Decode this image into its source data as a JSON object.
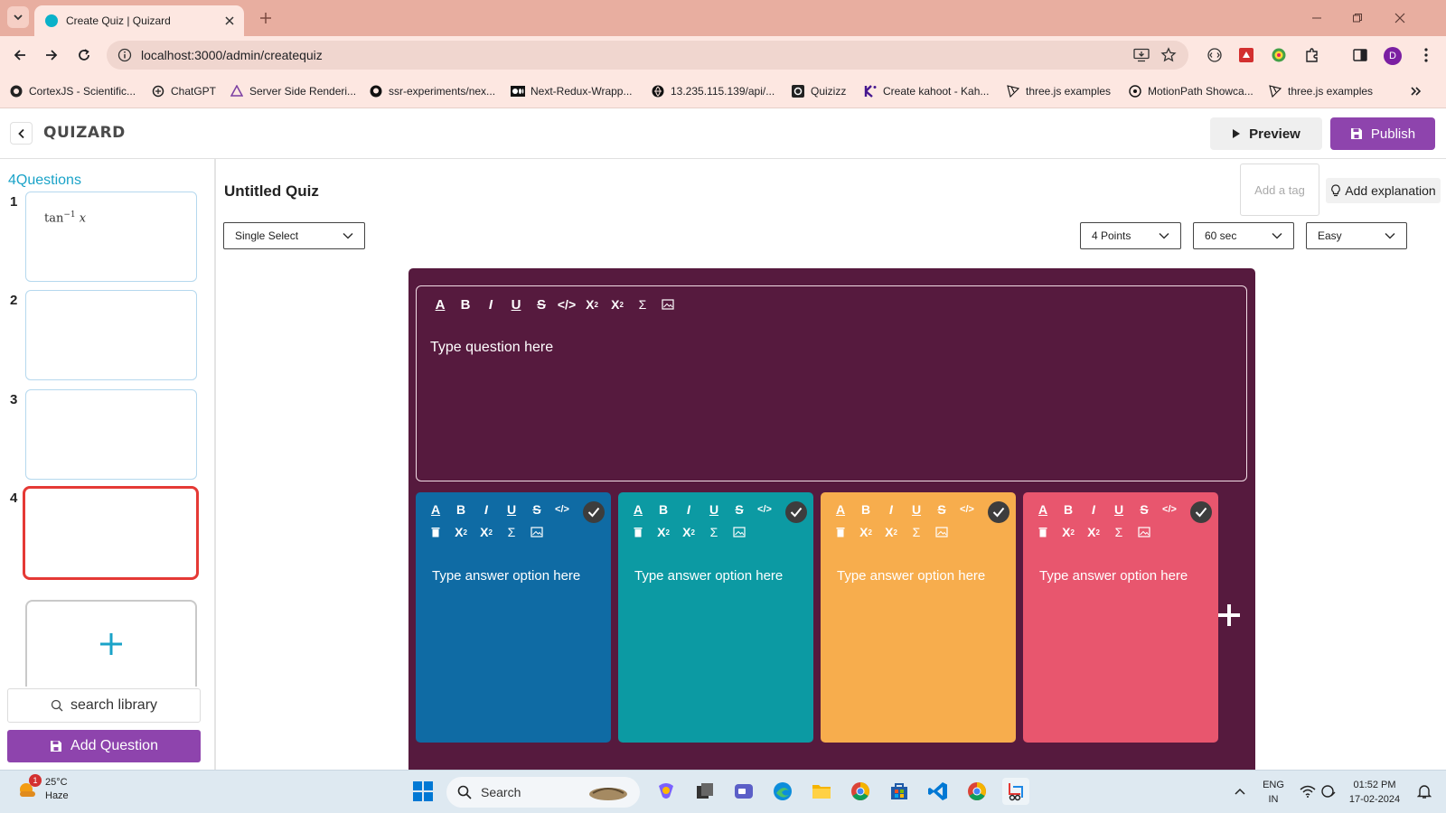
{
  "browser": {
    "tab_title": "Create Quiz | Quizard",
    "url": "localhost:3000/admin/createquiz",
    "profile_initial": "D",
    "bookmarks": [
      {
        "label": "CortexJS - Scientific...",
        "icon": "cortexjs-icon"
      },
      {
        "label": "ChatGPT",
        "icon": "chatgpt-icon"
      },
      {
        "label": "Server Side Renderi...",
        "icon": "server-side-icon"
      },
      {
        "label": "ssr-experiments/nex...",
        "icon": "github-icon"
      },
      {
        "label": "Next-Redux-Wrapp...",
        "icon": "medium-icon"
      },
      {
        "label": "13.235.115.139/api/...",
        "icon": "globe-icon"
      },
      {
        "label": "Quizizz",
        "icon": "quizizz-icon"
      },
      {
        "label": "Create kahoot - Kah...",
        "icon": "kahoot-icon"
      },
      {
        "label": "three.js examples",
        "icon": "threejs-icon"
      },
      {
        "label": "MotionPath Showca...",
        "icon": "motionpath-icon"
      },
      {
        "label": "three.js examples",
        "icon": "threejs-icon"
      }
    ]
  },
  "header": {
    "logo": "QUIZARD",
    "preview_label": "Preview",
    "publish_label": "Publish"
  },
  "sidebar": {
    "question_count": "4Questions",
    "questions": [
      {
        "number": "1",
        "preview": "tan",
        "sup": "−1",
        "var": "x"
      },
      {
        "number": "2"
      },
      {
        "number": "3"
      },
      {
        "number": "4"
      }
    ],
    "search_label": "search library",
    "add_question_label": "Add Question"
  },
  "main": {
    "quiz_title": "Untitled Quiz",
    "tag_placeholder": "Add a tag",
    "explanation_label": "Add explanation",
    "question_type": "Single Select",
    "points": "4 Points",
    "time": "60 sec",
    "difficulty": "Easy",
    "question_placeholder": "Type question here",
    "answers": [
      {
        "placeholder": "Type answer option here",
        "color": "#0f6ba4"
      },
      {
        "placeholder": "Type answer option here",
        "color": "#0c9aa3"
      },
      {
        "placeholder": "Type answer option here",
        "color": "#f7ad4d"
      },
      {
        "placeholder": "Type answer option here",
        "color": "#e8566e"
      }
    ]
  },
  "taskbar": {
    "temperature": "25°C",
    "condition": "Haze",
    "weather_badge": "1",
    "search_label": "Search",
    "lang_1": "ENG",
    "lang_2": "IN",
    "time": "01:52 PM",
    "date": "17-02-2024"
  },
  "colors": {
    "accent_purple": "#8e44ad",
    "editor_bg": "#561a3e",
    "active_border": "#e53935",
    "question_count": "#1aa3c8"
  }
}
